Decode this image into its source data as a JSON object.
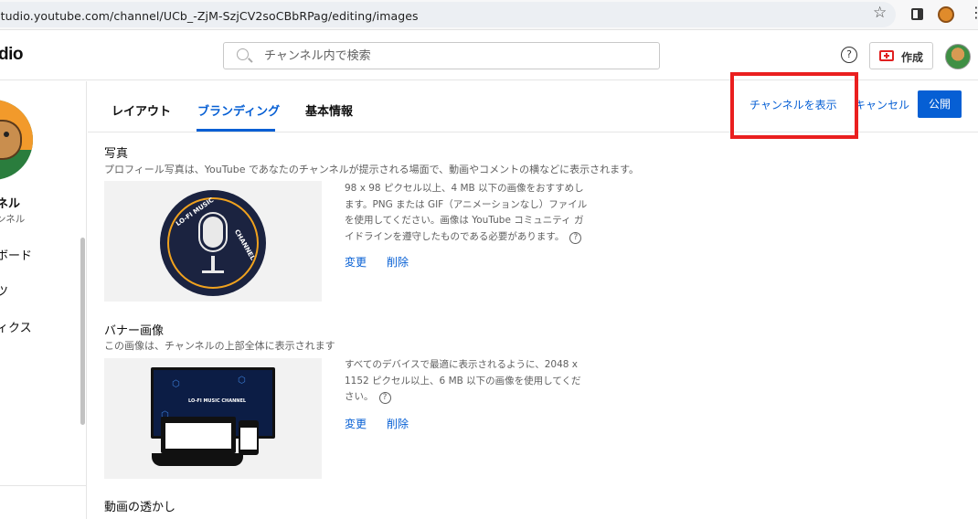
{
  "browser": {
    "url": "studio.youtube.com/channel/UCb_-ZjM-SzjCV2soCBbRPag/editing/images"
  },
  "header": {
    "logo_text": "dio",
    "search_placeholder": "チャンネル内で検索",
    "help_label": "?",
    "create_label": "作成"
  },
  "sidebar": {
    "channel_name": "ネル",
    "channel_sub": "ンネル",
    "items": [
      {
        "label": "ボード"
      },
      {
        "label": "ツ"
      },
      {
        "label": "ィクス"
      }
    ]
  },
  "tabs": [
    {
      "label": "レイアウト",
      "active": false
    },
    {
      "label": "ブランディング",
      "active": true
    },
    {
      "label": "基本情報",
      "active": false
    }
  ],
  "actions": {
    "view_channel": "チャンネルを表示",
    "cancel": "キャンセル",
    "publish": "公開"
  },
  "photo": {
    "title": "写真",
    "description": "プロフィール写真は、YouTube であなたのチャンネルが提示される場面で、動画やコメントの横などに表示されます。",
    "info": "98 x 98 ピクセル以上、4 MB 以下の画像をおすすめします。PNG または GIF（アニメーションなし）ファイルを使用してください。画像は YouTube コミュニティ ガイドラインを遵守したものである必要があります。",
    "change": "変更",
    "delete": "削除",
    "logo_top_text": "LO-FI MUSIC",
    "logo_side_text": "CHANNEL"
  },
  "banner": {
    "title": "バナー画像",
    "description": "この画像は、チャンネルの上部全体に表示されます",
    "info": "すべてのデバイスで最適に表示されるように、2048 x 1152 ピクセル以上、6 MB 以下の画像を使用してください。",
    "change": "変更",
    "delete": "削除",
    "screen_title": "LO-FI MUSIC CHANNEL"
  },
  "watermark": {
    "title": "動画の透かし"
  },
  "colors": {
    "accent": "#065fd4",
    "highlight": "#ea1f1f"
  }
}
